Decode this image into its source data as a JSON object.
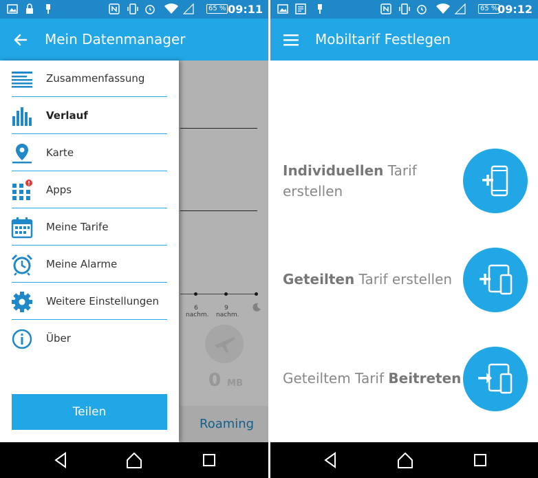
{
  "left": {
    "status": {
      "battery": "65 %",
      "time": "09:11"
    },
    "appbar": {
      "title": "Mein Datenmanager"
    },
    "drawer": {
      "items": [
        {
          "label": "Zusammenfassung"
        },
        {
          "label": "Verlauf"
        },
        {
          "label": "Karte"
        },
        {
          "label": "Apps"
        },
        {
          "label": "Meine Tarife"
        },
        {
          "label": "Meine Alarme"
        },
        {
          "label": "Weitere Einstellungen"
        },
        {
          "label": "Über"
        }
      ],
      "share_label": "Teilen"
    },
    "background": {
      "ticks": [
        {
          "value": "6",
          "unit": "nachm."
        },
        {
          "value": "9",
          "unit": "nachm."
        }
      ],
      "data_value": "0",
      "data_unit": "MB",
      "roaming_label": "Roaming"
    }
  },
  "right": {
    "status": {
      "battery": "65 %",
      "time": "09:12"
    },
    "appbar": {
      "title": "Mobiltarif Festlegen"
    },
    "options": [
      {
        "bold": "Individuellen",
        "rest": " Tarif",
        "line2": "erstellen"
      },
      {
        "bold": "Geteilten",
        "rest": " Tarif erstellen"
      },
      {
        "pre": "Geteiltem Tarif ",
        "bold": "Beitreten"
      }
    ]
  },
  "colors": {
    "accent": "#22a7e6",
    "statusbar": "#1e88c8",
    "navbar": "#000000"
  }
}
